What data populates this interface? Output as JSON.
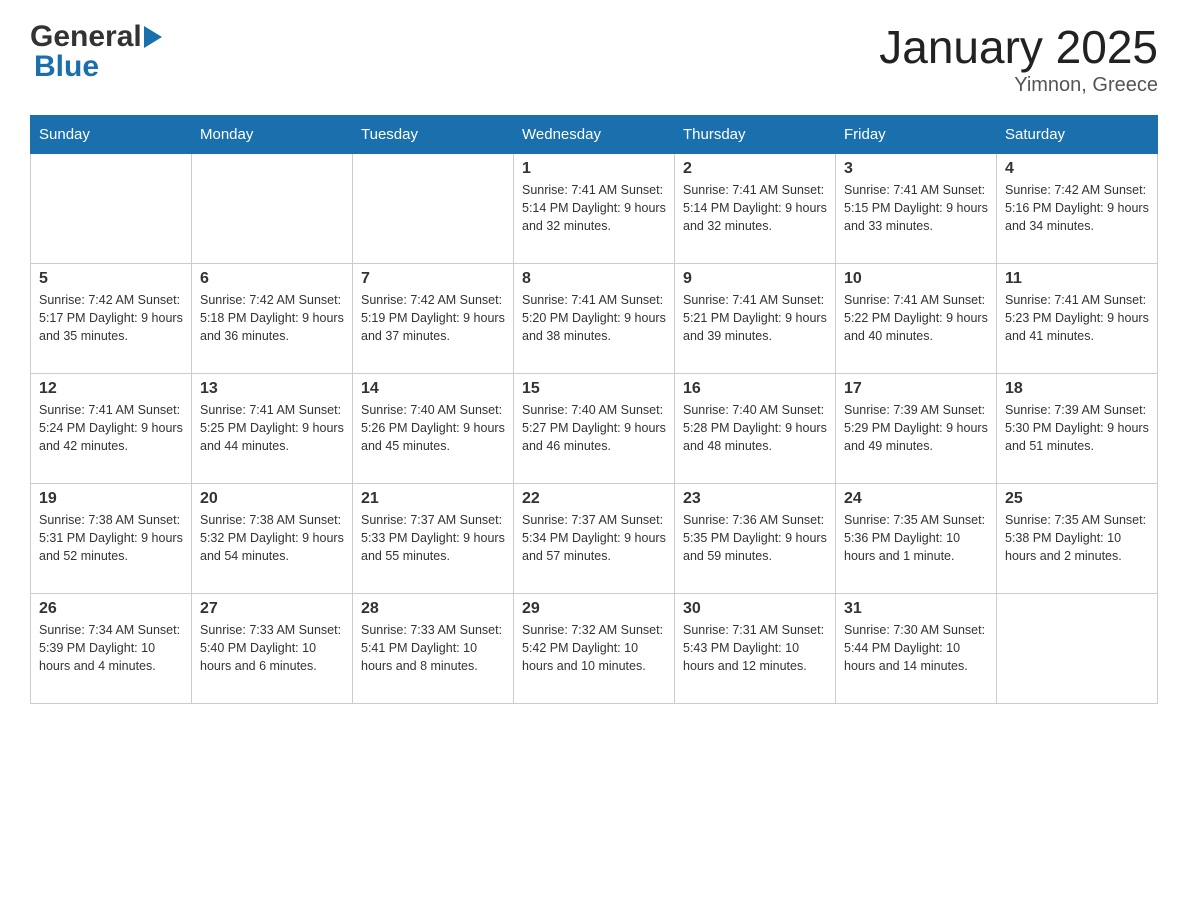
{
  "header": {
    "logo_general": "General",
    "logo_blue": "Blue",
    "title": "January 2025",
    "subtitle": "Yimnon, Greece"
  },
  "calendar": {
    "days_of_week": [
      "Sunday",
      "Monday",
      "Tuesday",
      "Wednesday",
      "Thursday",
      "Friday",
      "Saturday"
    ],
    "weeks": [
      [
        {
          "day": "",
          "info": ""
        },
        {
          "day": "",
          "info": ""
        },
        {
          "day": "",
          "info": ""
        },
        {
          "day": "1",
          "info": "Sunrise: 7:41 AM\nSunset: 5:14 PM\nDaylight: 9 hours\nand 32 minutes."
        },
        {
          "day": "2",
          "info": "Sunrise: 7:41 AM\nSunset: 5:14 PM\nDaylight: 9 hours\nand 32 minutes."
        },
        {
          "day": "3",
          "info": "Sunrise: 7:41 AM\nSunset: 5:15 PM\nDaylight: 9 hours\nand 33 minutes."
        },
        {
          "day": "4",
          "info": "Sunrise: 7:42 AM\nSunset: 5:16 PM\nDaylight: 9 hours\nand 34 minutes."
        }
      ],
      [
        {
          "day": "5",
          "info": "Sunrise: 7:42 AM\nSunset: 5:17 PM\nDaylight: 9 hours\nand 35 minutes."
        },
        {
          "day": "6",
          "info": "Sunrise: 7:42 AM\nSunset: 5:18 PM\nDaylight: 9 hours\nand 36 minutes."
        },
        {
          "day": "7",
          "info": "Sunrise: 7:42 AM\nSunset: 5:19 PM\nDaylight: 9 hours\nand 37 minutes."
        },
        {
          "day": "8",
          "info": "Sunrise: 7:41 AM\nSunset: 5:20 PM\nDaylight: 9 hours\nand 38 minutes."
        },
        {
          "day": "9",
          "info": "Sunrise: 7:41 AM\nSunset: 5:21 PM\nDaylight: 9 hours\nand 39 minutes."
        },
        {
          "day": "10",
          "info": "Sunrise: 7:41 AM\nSunset: 5:22 PM\nDaylight: 9 hours\nand 40 minutes."
        },
        {
          "day": "11",
          "info": "Sunrise: 7:41 AM\nSunset: 5:23 PM\nDaylight: 9 hours\nand 41 minutes."
        }
      ],
      [
        {
          "day": "12",
          "info": "Sunrise: 7:41 AM\nSunset: 5:24 PM\nDaylight: 9 hours\nand 42 minutes."
        },
        {
          "day": "13",
          "info": "Sunrise: 7:41 AM\nSunset: 5:25 PM\nDaylight: 9 hours\nand 44 minutes."
        },
        {
          "day": "14",
          "info": "Sunrise: 7:40 AM\nSunset: 5:26 PM\nDaylight: 9 hours\nand 45 minutes."
        },
        {
          "day": "15",
          "info": "Sunrise: 7:40 AM\nSunset: 5:27 PM\nDaylight: 9 hours\nand 46 minutes."
        },
        {
          "day": "16",
          "info": "Sunrise: 7:40 AM\nSunset: 5:28 PM\nDaylight: 9 hours\nand 48 minutes."
        },
        {
          "day": "17",
          "info": "Sunrise: 7:39 AM\nSunset: 5:29 PM\nDaylight: 9 hours\nand 49 minutes."
        },
        {
          "day": "18",
          "info": "Sunrise: 7:39 AM\nSunset: 5:30 PM\nDaylight: 9 hours\nand 51 minutes."
        }
      ],
      [
        {
          "day": "19",
          "info": "Sunrise: 7:38 AM\nSunset: 5:31 PM\nDaylight: 9 hours\nand 52 minutes."
        },
        {
          "day": "20",
          "info": "Sunrise: 7:38 AM\nSunset: 5:32 PM\nDaylight: 9 hours\nand 54 minutes."
        },
        {
          "day": "21",
          "info": "Sunrise: 7:37 AM\nSunset: 5:33 PM\nDaylight: 9 hours\nand 55 minutes."
        },
        {
          "day": "22",
          "info": "Sunrise: 7:37 AM\nSunset: 5:34 PM\nDaylight: 9 hours\nand 57 minutes."
        },
        {
          "day": "23",
          "info": "Sunrise: 7:36 AM\nSunset: 5:35 PM\nDaylight: 9 hours\nand 59 minutes."
        },
        {
          "day": "24",
          "info": "Sunrise: 7:35 AM\nSunset: 5:36 PM\nDaylight: 10 hours\nand 1 minute."
        },
        {
          "day": "25",
          "info": "Sunrise: 7:35 AM\nSunset: 5:38 PM\nDaylight: 10 hours\nand 2 minutes."
        }
      ],
      [
        {
          "day": "26",
          "info": "Sunrise: 7:34 AM\nSunset: 5:39 PM\nDaylight: 10 hours\nand 4 minutes."
        },
        {
          "day": "27",
          "info": "Sunrise: 7:33 AM\nSunset: 5:40 PM\nDaylight: 10 hours\nand 6 minutes."
        },
        {
          "day": "28",
          "info": "Sunrise: 7:33 AM\nSunset: 5:41 PM\nDaylight: 10 hours\nand 8 minutes."
        },
        {
          "day": "29",
          "info": "Sunrise: 7:32 AM\nSunset: 5:42 PM\nDaylight: 10 hours\nand 10 minutes."
        },
        {
          "day": "30",
          "info": "Sunrise: 7:31 AM\nSunset: 5:43 PM\nDaylight: 10 hours\nand 12 minutes."
        },
        {
          "day": "31",
          "info": "Sunrise: 7:30 AM\nSunset: 5:44 PM\nDaylight: 10 hours\nand 14 minutes."
        },
        {
          "day": "",
          "info": ""
        }
      ]
    ]
  }
}
